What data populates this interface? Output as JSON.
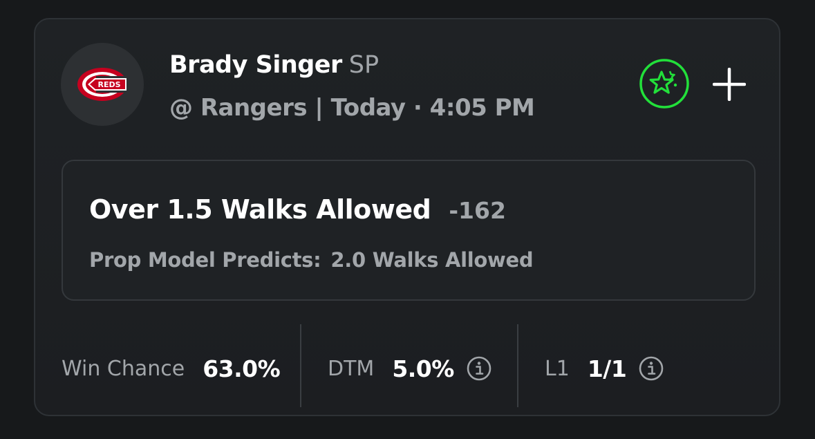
{
  "card": {
    "team_logo": {
      "icon": "reds-logo",
      "text": "REDS",
      "colors": {
        "red": "#c6011f",
        "white": "#ffffff",
        "background": "#2d3033"
      }
    },
    "player": {
      "name": "Brady Singer",
      "position": "SP"
    },
    "game_info": "@ Rangers | Today · 4:05 PM",
    "actions": {
      "favorite_icon": "star-in-circle-icon",
      "favorite_color": "#22e03a",
      "add_icon": "plus-icon"
    },
    "prop": {
      "title": "Over 1.5 Walks Allowed",
      "odds": "-162",
      "model_label": "Prop Model Predicts:",
      "model_value": "2.0 Walks Allowed"
    },
    "stats": [
      {
        "label": "Win Chance",
        "value": "63.0%",
        "info": false
      },
      {
        "label": "DTM",
        "value": "5.0%",
        "info": true,
        "info_icon": "info-icon"
      },
      {
        "label": "L1",
        "value": "1/1",
        "info": true,
        "info_icon": "info-icon"
      }
    ]
  }
}
